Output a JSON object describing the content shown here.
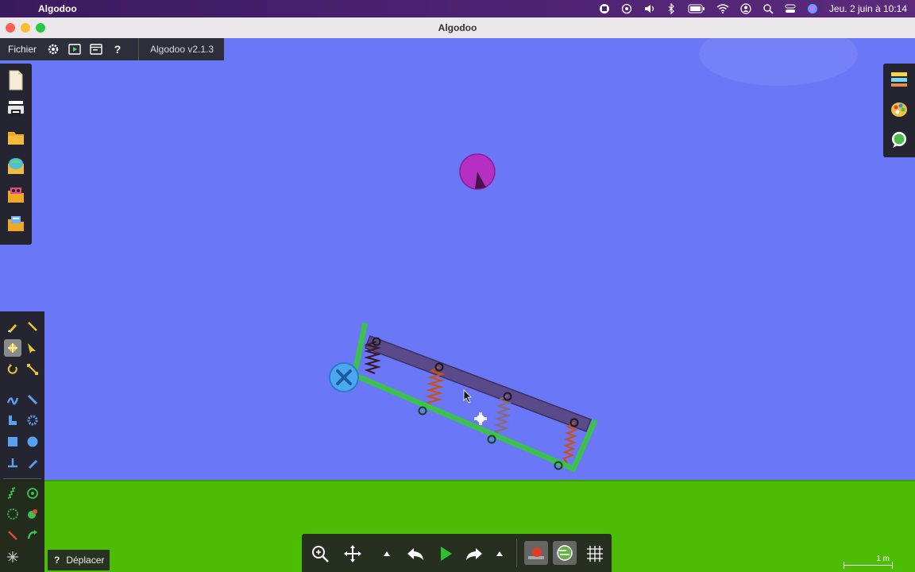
{
  "menubar": {
    "app_name": "Algodoo",
    "datetime": "Jeu. 2 juin à 10:14"
  },
  "window": {
    "title": "Algodoo"
  },
  "toolbar": {
    "file_label": "Fichier",
    "version": "Algodoo v2.1.3"
  },
  "hint": {
    "label": "Déplacer"
  },
  "scale": {
    "label": "1 m"
  },
  "colors": {
    "sky": "#6a77f6",
    "ground": "#4cbc04",
    "frame": "#3cc050",
    "bar": "#5a4a8a",
    "ball": "#b52fc2",
    "spring": "#c8501e",
    "hinge": "#4aa8f0"
  },
  "icons": {
    "top": [
      "settings-gear-icon",
      "play-scene-icon",
      "window-icon",
      "help-icon"
    ],
    "left": [
      "new-scene-icon",
      "printer-icon",
      "open-folder-icon",
      "algobox-icon",
      "scenes-folder-icon",
      "downloads-folder-icon"
    ],
    "right": [
      "layers-icon",
      "palette-icon",
      "chat-bubble-icon"
    ],
    "bottom": [
      "zoom-icon",
      "pan-icon",
      "undo-arrow-icon",
      "play-icon",
      "redo-arrow-icon",
      "gravity-apple-icon",
      "air-icon",
      "grid-icon"
    ]
  }
}
